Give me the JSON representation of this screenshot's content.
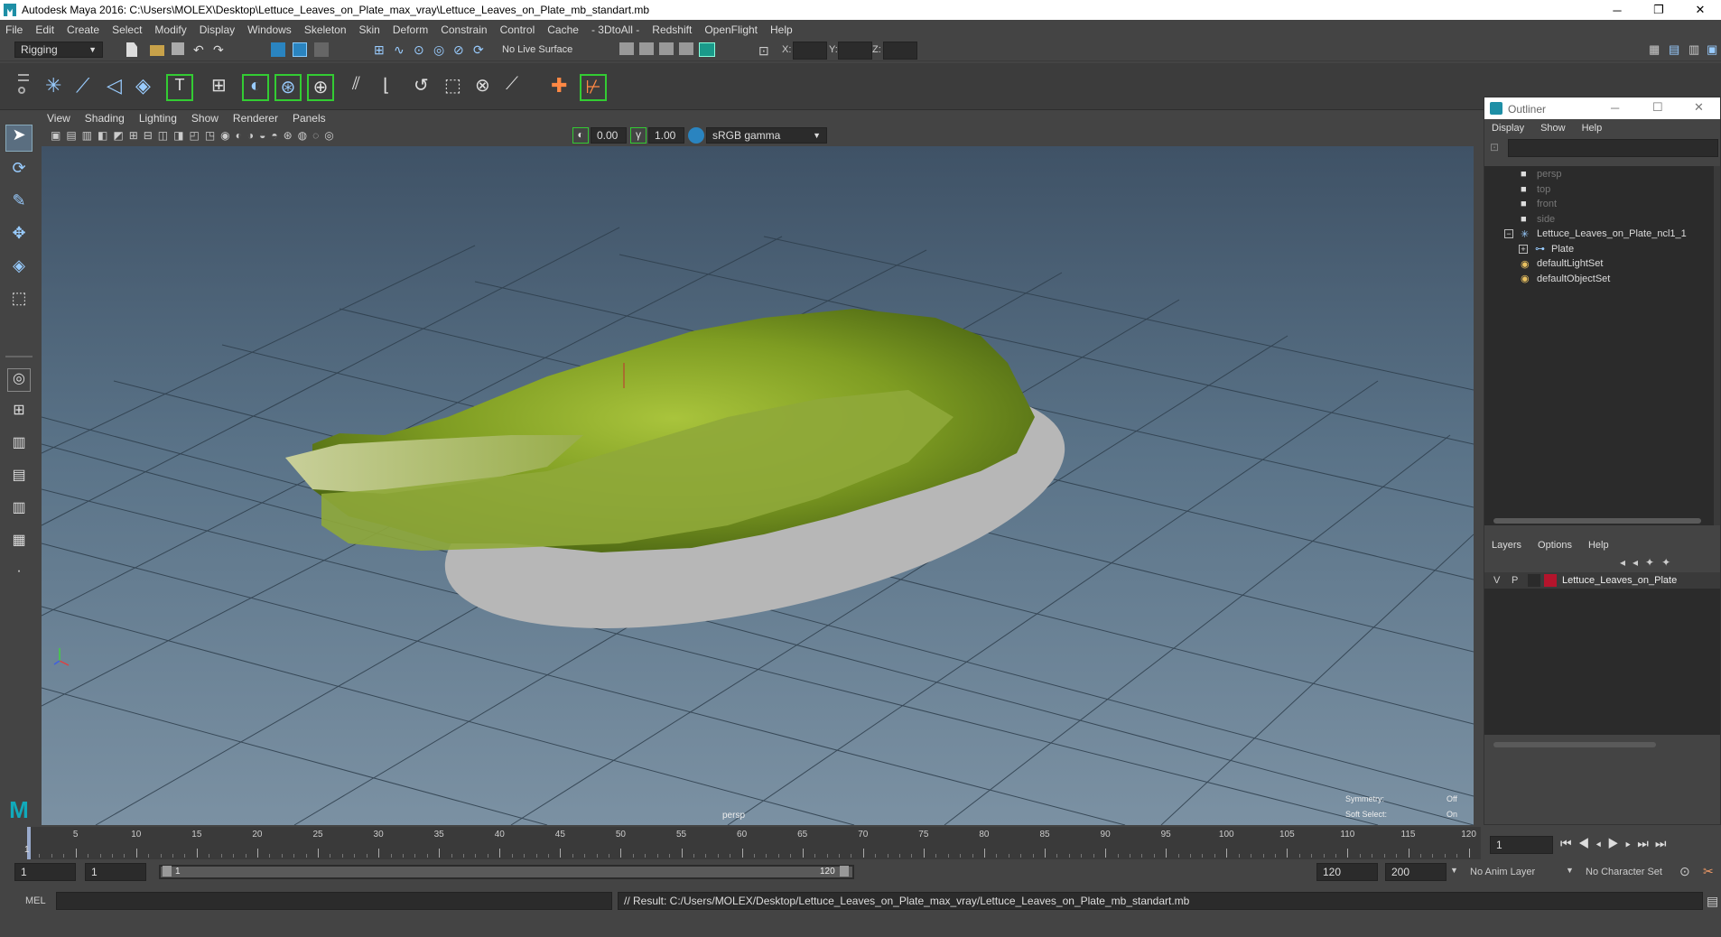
{
  "window": {
    "title": "Autodesk Maya 2016: C:\\Users\\MOLEX\\Desktop\\Lettuce_Leaves_on_Plate_max_vray\\Lettuce_Leaves_on_Plate_mb_standart.mb",
    "min": "─",
    "restore": "❐",
    "close": "✕"
  },
  "menubar": [
    "File",
    "Edit",
    "Create",
    "Select",
    "Modify",
    "Display",
    "Windows",
    "Skeleton",
    "Skin",
    "Deform",
    "Constrain",
    "Control",
    "Cache",
    "- 3DtoAll -",
    "Redshift",
    "OpenFlight",
    "Help"
  ],
  "statusline": {
    "mode": "Rigging",
    "live_surface": "No Live Surface",
    "x_label": "X:",
    "y_label": "Y:",
    "z_label": "Z:"
  },
  "panel": {
    "menus": [
      "View",
      "Shading",
      "Lighting",
      "Show",
      "Renderer",
      "Panels"
    ],
    "exposure": "0.00",
    "gamma": "1.00",
    "colorspace": "sRGB gamma",
    "camera_label": "persp",
    "symmetry_label": "Symmetry:",
    "symmetry_value": "Off",
    "soft_select_label": "Soft Select:",
    "soft_select_value": "On"
  },
  "outliner": {
    "title": "Outliner",
    "menus": [
      "Display",
      "Show",
      "Help"
    ],
    "items": [
      {
        "label": "persp",
        "type": "camera",
        "dim": true
      },
      {
        "label": "top",
        "type": "camera",
        "dim": true
      },
      {
        "label": "front",
        "type": "camera",
        "dim": true
      },
      {
        "label": "side",
        "type": "camera",
        "dim": true
      },
      {
        "label": "Lettuce_Leaves_on_Plate_ncl1_1",
        "type": "group",
        "dim": false
      },
      {
        "label": "Plate",
        "type": "mesh",
        "dim": false
      },
      {
        "label": "defaultLightSet",
        "type": "set",
        "dim": false
      },
      {
        "label": "defaultObjectSet",
        "type": "set",
        "dim": false
      }
    ],
    "layer_menus": [
      "Layers",
      "Options",
      "Help"
    ],
    "layer": {
      "v": "V",
      "p": "P",
      "name": "Lettuce_Leaves_on_Plate",
      "color": "#b4142c"
    }
  },
  "timeline": {
    "ticks": [
      "5",
      "10",
      "15",
      "20",
      "25",
      "30",
      "35",
      "40",
      "45",
      "50",
      "55",
      "60",
      "65",
      "70",
      "75",
      "80",
      "85",
      "90",
      "95",
      "100",
      "105",
      "110",
      "115",
      "120"
    ],
    "start_marker": "1",
    "current_frame": "1"
  },
  "range": {
    "start": "1",
    "playback_start": "1",
    "slider_start": "1",
    "slider_end": "120",
    "playback_end": "120",
    "end": "200",
    "anim_layer": "No Anim Layer",
    "character_set": "No Character Set"
  },
  "cmdline": {
    "lang": "MEL",
    "result": "// Result: C:/Users/MOLEX/Desktop/Lettuce_Leaves_on_Plate_max_vray/Lettuce_Leaves_on_Plate_mb_standart.mb"
  }
}
